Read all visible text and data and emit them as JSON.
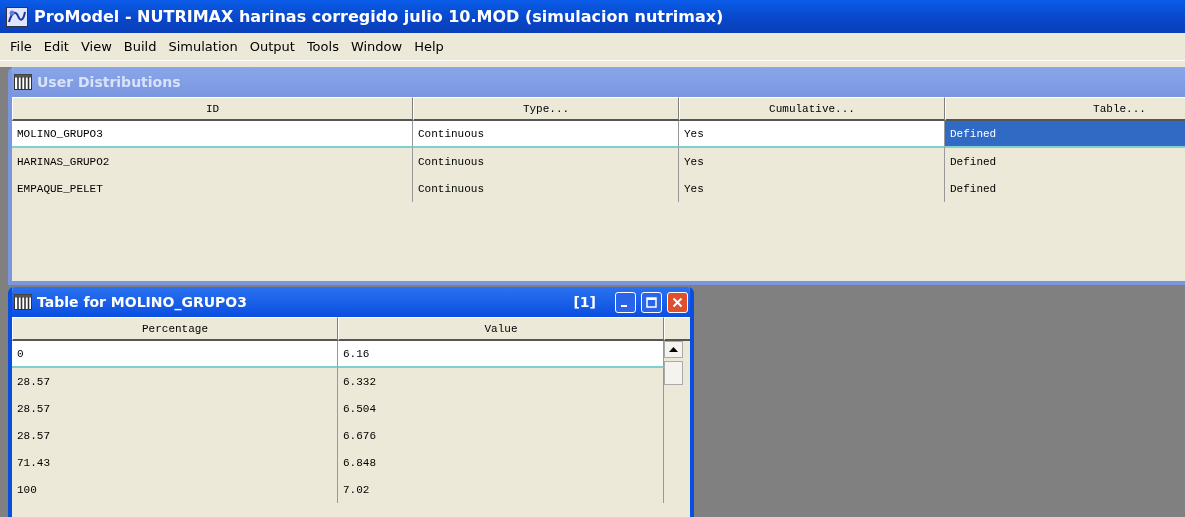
{
  "window": {
    "title": "ProModel - NUTRIMAX harinas corregido julio 10.MOD (simulacion nutrimax)"
  },
  "menu": [
    "File",
    "Edit",
    "View",
    "Build",
    "Simulation",
    "Output",
    "Tools",
    "Window",
    "Help"
  ],
  "user_distributions": {
    "title": "User Distributions",
    "active": false,
    "columns": [
      "ID",
      "Type...",
      "Cumulative...",
      "Table..."
    ],
    "rows": [
      {
        "cells": [
          "MOLINO_GRUPO3",
          "Continuous",
          "Yes",
          "Defined"
        ],
        "selected": true,
        "last_cell_highlighted": true
      },
      {
        "cells": [
          "HARINAS_GRUPO2",
          "Continuous",
          "Yes",
          "Defined"
        ],
        "selected": false,
        "last_cell_highlighted": false
      },
      {
        "cells": [
          "EMPAQUE_PELET",
          "Continuous",
          "Yes",
          "Defined"
        ],
        "selected": false,
        "last_cell_highlighted": false
      }
    ]
  },
  "table_window": {
    "title": "Table for MOLINO_GRUPO3",
    "active": true,
    "index": "[1]",
    "columns": [
      "Percentage",
      "Value"
    ],
    "rows": [
      {
        "cells": [
          "0",
          "6.16"
        ],
        "selected": true
      },
      {
        "cells": [
          "28.57",
          "6.332"
        ],
        "selected": false
      },
      {
        "cells": [
          "28.57",
          "6.504"
        ],
        "selected": false
      },
      {
        "cells": [
          "28.57",
          "6.676"
        ],
        "selected": false
      },
      {
        "cells": [
          "71.43",
          "6.848"
        ],
        "selected": false
      },
      {
        "cells": [
          "100",
          "7.02"
        ],
        "selected": false
      }
    ]
  }
}
